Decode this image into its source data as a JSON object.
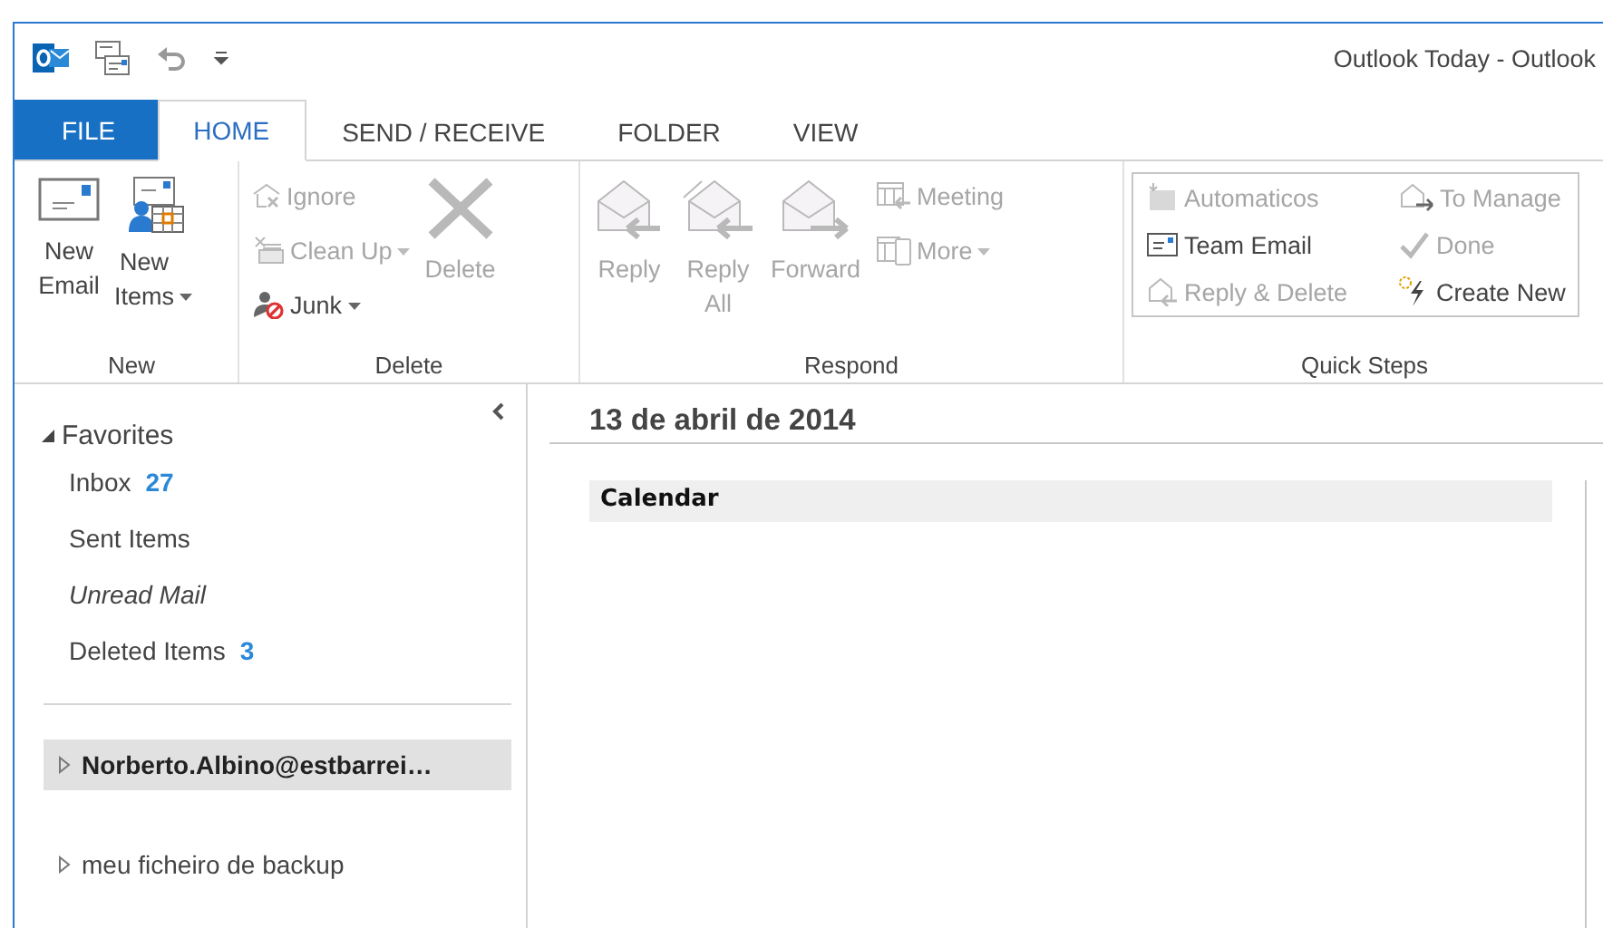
{
  "window": {
    "title": "Outlook Today - Outlook"
  },
  "tabs": [
    {
      "label": "FILE",
      "kind": "backstage",
      "selected": false
    },
    {
      "label": "HOME",
      "kind": "tab",
      "selected": true
    },
    {
      "label": "SEND / RECEIVE",
      "kind": "tab",
      "selected": false
    },
    {
      "label": "FOLDER",
      "kind": "tab",
      "selected": false
    },
    {
      "label": "VIEW",
      "kind": "tab",
      "selected": false
    }
  ],
  "ribbon": {
    "groups": [
      {
        "label": "New",
        "kind": "buttons",
        "buttons": [
          {
            "label": "New Email",
            "kind": "large",
            "disabled": false,
            "dropdown": false
          },
          {
            "label": "New Items",
            "kind": "large",
            "disabled": false,
            "dropdown": true
          }
        ]
      },
      {
        "label": "Delete",
        "kind": "buttons",
        "buttons": [
          {
            "label": "Ignore",
            "kind": "small",
            "disabled": true,
            "dropdown": false
          },
          {
            "label": "Clean Up",
            "kind": "small",
            "disabled": true,
            "dropdown": true
          },
          {
            "label": "Junk",
            "kind": "small",
            "disabled": false,
            "dropdown": true
          },
          {
            "label": "Delete",
            "kind": "large",
            "disabled": true,
            "dropdown": false
          }
        ]
      },
      {
        "label": "Respond",
        "kind": "buttons",
        "buttons": [
          {
            "label": "Reply",
            "kind": "large",
            "disabled": true,
            "dropdown": false
          },
          {
            "label": "Reply All",
            "kind": "large",
            "disabled": true,
            "dropdown": false
          },
          {
            "label": "Forward",
            "kind": "large",
            "disabled": true,
            "dropdown": false
          },
          {
            "label": "Meeting",
            "kind": "small",
            "disabled": true,
            "dropdown": false
          },
          {
            "label": "More",
            "kind": "small",
            "disabled": true,
            "dropdown": true
          }
        ]
      },
      {
        "label": "Quick Steps",
        "kind": "gallery",
        "buttons": [
          {
            "label": "Automaticos",
            "kind": "small",
            "disabled": true,
            "dropdown": false
          },
          {
            "label": "Team Email",
            "kind": "small",
            "disabled": false,
            "dropdown": false
          },
          {
            "label": "Reply & Delete",
            "kind": "small",
            "disabled": true,
            "dropdown": false
          },
          {
            "label": "To Manage",
            "kind": "small",
            "disabled": true,
            "dropdown": false
          },
          {
            "label": "Done",
            "kind": "small",
            "disabled": true,
            "dropdown": false
          },
          {
            "label": "Create New",
            "kind": "small",
            "disabled": false,
            "dropdown": false
          }
        ]
      }
    ]
  },
  "navigation": {
    "favorites": {
      "label": "Favorites",
      "expanded": true,
      "items": [
        {
          "label": "Inbox",
          "count": "27",
          "kind": "folder"
        },
        {
          "label": "Sent Items",
          "kind": "folder"
        },
        {
          "label": "Unread Mail",
          "kind": "search-folder"
        },
        {
          "label": "Deleted Items",
          "count": "3",
          "kind": "folder"
        }
      ]
    },
    "accounts": [
      {
        "label": "Norberto.Albino@estbarrei…",
        "selected": true,
        "expanded": false
      },
      {
        "label": "meu ficheiro de backup",
        "selected": false,
        "expanded": false
      }
    ]
  },
  "outlook_today": {
    "date": "13 de abril de 2014",
    "sections": [
      {
        "title": "Calendar"
      }
    ]
  }
}
